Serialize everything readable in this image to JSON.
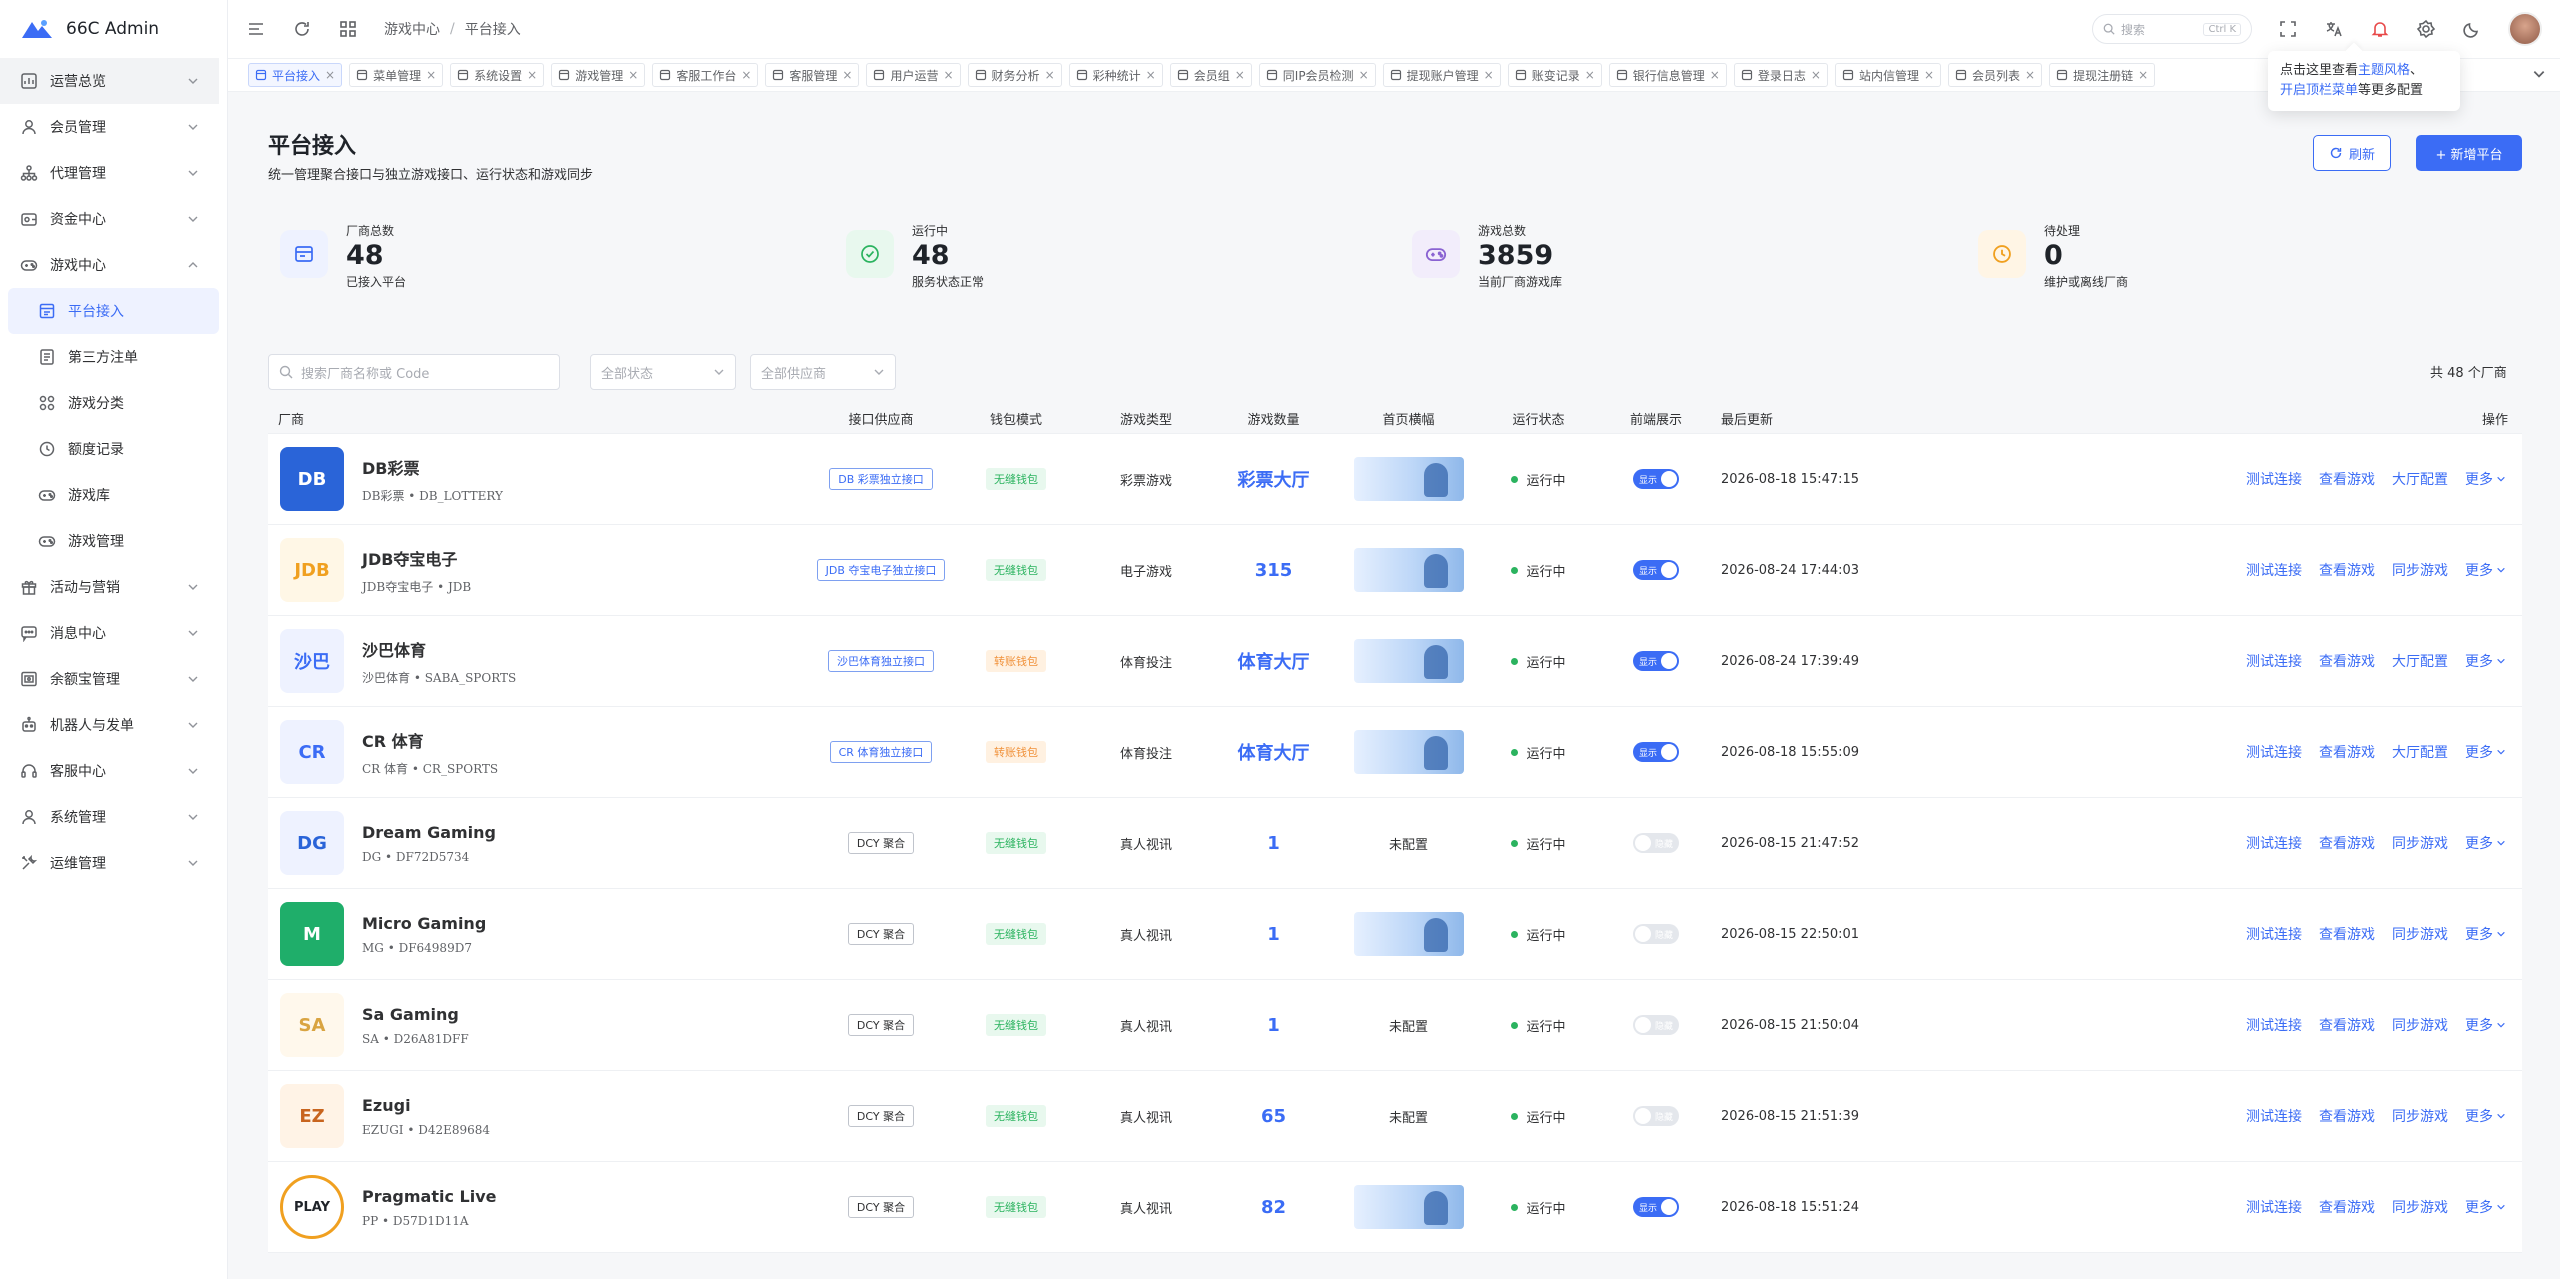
{
  "app": {
    "title": "66C Admin"
  },
  "sidebar": {
    "items": [
      {
        "label": "运营总览",
        "icon": "dashboard-icon",
        "open_bg": true
      },
      {
        "label": "会员管理",
        "icon": "user-icon"
      },
      {
        "label": "代理管理",
        "icon": "agent-tree-icon"
      },
      {
        "label": "资金中心",
        "icon": "wallet-icon"
      },
      {
        "label": "游戏中心",
        "icon": "gamepad-icon",
        "expanded": true
      }
    ],
    "game_sub": [
      {
        "label": "平台接入",
        "icon": "platform-icon",
        "active": true
      },
      {
        "label": "第三方注单",
        "icon": "document-icon"
      },
      {
        "label": "游戏分类",
        "icon": "grid-icon"
      },
      {
        "label": "额度记录",
        "icon": "clock-icon"
      },
      {
        "label": "游戏库",
        "icon": "gamepad-icon"
      },
      {
        "label": "游戏管理",
        "icon": "gamepad-icon"
      }
    ],
    "items_after": [
      {
        "label": "活动与营销",
        "icon": "gift-icon"
      },
      {
        "label": "消息中心",
        "icon": "message-icon"
      },
      {
        "label": "余额宝管理",
        "icon": "safe-icon"
      },
      {
        "label": "机器人与发单",
        "icon": "robot-icon"
      },
      {
        "label": "客服中心",
        "icon": "headset-icon"
      },
      {
        "label": "系统管理",
        "icon": "user-icon"
      },
      {
        "label": "运维管理",
        "icon": "tools-icon"
      }
    ]
  },
  "header": {
    "breadcrumb": [
      "游戏中心",
      "平台接入"
    ],
    "search_placeholder": "搜索",
    "search_kbd": "Ctrl K"
  },
  "tabs": [
    {
      "label": "平台接入",
      "active": true
    },
    {
      "label": "菜单管理"
    },
    {
      "label": "系统设置"
    },
    {
      "label": "游戏管理"
    },
    {
      "label": "客服工作台"
    },
    {
      "label": "客服管理"
    },
    {
      "label": "用户运营"
    },
    {
      "label": "财务分析"
    },
    {
      "label": "彩种统计"
    },
    {
      "label": "会员组"
    },
    {
      "label": "同IP会员检测"
    },
    {
      "label": "提现账户管理"
    },
    {
      "label": "账变记录"
    },
    {
      "label": "银行信息管理"
    },
    {
      "label": "登录日志"
    },
    {
      "label": "站内信管理"
    },
    {
      "label": "会员列表"
    },
    {
      "label": "提现注册链"
    }
  ],
  "tooltip": {
    "pre": "点击这里查看",
    "link1": "主题风格",
    "mid": "、",
    "link2": "开启顶栏菜单",
    "post": "等更多配置"
  },
  "page": {
    "title": "平台接入",
    "desc": "统一管理聚合接口与独立游戏接口、运行状态和游戏同步",
    "refresh": "刷新",
    "add": "+ 新增平台"
  },
  "stats": [
    {
      "label": "厂商总数",
      "value": "48",
      "sub": "已接入平台",
      "color": "#3b6cf5",
      "bg": "#eef2ff",
      "icon": "card-icon"
    },
    {
      "label": "运行中",
      "value": "48",
      "sub": "服务状态正常",
      "color": "#2bb35f",
      "bg": "#e8f8ee",
      "icon": "check-circle-icon"
    },
    {
      "label": "游戏总数",
      "value": "3859",
      "sub": "当前厂商游戏库",
      "color": "#8a63d2",
      "bg": "#f2edfb",
      "icon": "gamepad-icon"
    },
    {
      "label": "待处理",
      "value": "0",
      "sub": "维护或离线厂商",
      "color": "#f0a020",
      "bg": "#fff5e5",
      "icon": "clock-icon"
    }
  ],
  "filters": {
    "search_placeholder": "搜索厂商名称或 Code",
    "status": "全部状态",
    "supplier": "全部供应商",
    "total": "共 48 个厂商"
  },
  "table": {
    "headers": {
      "name": "厂商",
      "api": "接口供应商",
      "wallet": "钱包模式",
      "type": "游戏类型",
      "count": "游戏数量",
      "banner": "首页横幅",
      "status": "运行状态",
      "front": "前端展示",
      "updated": "最后更新",
      "ops": "操作"
    },
    "rows": [
      {
        "name": "DB彩票",
        "code": "DB彩票 • DB_LOTTERY",
        "logo": "DB",
        "logo_bg": "#2a64d8",
        "logo_fg": "#fff",
        "api": "DB 彩票独立接口",
        "api_gray": false,
        "wallet": "无缝钱包",
        "wallet_kind": "g",
        "type": "彩票游戏",
        "count": "彩票大厅",
        "banner": true,
        "status": "运行中",
        "front": "显示",
        "front_on": true,
        "updated": "2026-08-18 15:47:15",
        "ops": [
          "测试连接",
          "查看游戏",
          "大厅配置"
        ],
        "more": "更多"
      },
      {
        "name": "JDB夺宝电子",
        "code": "JDB夺宝电子 • JDB",
        "logo": "JDB",
        "logo_bg": "#fff7e6",
        "logo_fg": "#f0a020",
        "api": "JDB 夺宝电子独立接口",
        "api_gray": false,
        "wallet": "无缝钱包",
        "wallet_kind": "g",
        "type": "电子游戏",
        "count": "315",
        "banner": true,
        "status": "运行中",
        "front": "显示",
        "front_on": true,
        "updated": "2026-08-24 17:44:03",
        "ops": [
          "测试连接",
          "查看游戏",
          "同步游戏"
        ],
        "more": "更多"
      },
      {
        "name": "沙巴体育",
        "code": "沙巴体育 • SABA_SPORTS",
        "logo": "沙巴",
        "logo_bg": "#eef2ff",
        "logo_fg": "#3b6cf5",
        "api": "沙巴体育独立接口",
        "api_gray": false,
        "wallet": "转账钱包",
        "wallet_kind": "o",
        "type": "体育投注",
        "count": "体育大厅",
        "banner": true,
        "status": "运行中",
        "front": "显示",
        "front_on": true,
        "updated": "2026-08-24 17:39:49",
        "ops": [
          "测试连接",
          "查看游戏",
          "大厅配置"
        ],
        "more": "更多"
      },
      {
        "name": "CR 体育",
        "code": "CR 体育 • CR_SPORTS",
        "logo": "CR",
        "logo_bg": "#eef2ff",
        "logo_fg": "#3b6cf5",
        "api": "CR 体育独立接口",
        "api_gray": false,
        "wallet": "转账钱包",
        "wallet_kind": "o",
        "type": "体育投注",
        "count": "体育大厅",
        "banner": true,
        "status": "运行中",
        "front": "显示",
        "front_on": true,
        "updated": "2026-08-18 15:55:09",
        "ops": [
          "测试连接",
          "查看游戏",
          "大厅配置"
        ],
        "more": "更多"
      },
      {
        "name": "Dream Gaming",
        "code": "DG • DF72D5734",
        "logo": "DG",
        "logo_bg": "#eef2ff",
        "logo_fg": "#2a64d8",
        "api": "DCY 聚合",
        "api_gray": true,
        "wallet": "无缝钱包",
        "wallet_kind": "g",
        "type": "真人视讯",
        "count": "1",
        "banner": false,
        "banner_text": "未配置",
        "status": "运行中",
        "front": "隐藏",
        "front_on": false,
        "updated": "2026-08-15 21:47:52",
        "ops": [
          "测试连接",
          "查看游戏",
          "同步游戏"
        ],
        "more": "更多"
      },
      {
        "name": "Micro Gaming",
        "code": "MG • DF64989D7",
        "logo": "M",
        "logo_bg": "#1fae6a",
        "logo_fg": "#fff",
        "api": "DCY 聚合",
        "api_gray": true,
        "wallet": "无缝钱包",
        "wallet_kind": "g",
        "type": "真人视讯",
        "count": "1",
        "banner": true,
        "status": "运行中",
        "front": "隐藏",
        "front_on": false,
        "updated": "2026-08-15 22:50:01",
        "ops": [
          "测试连接",
          "查看游戏",
          "同步游戏"
        ],
        "more": "更多"
      },
      {
        "name": "Sa Gaming",
        "code": "SA • D26A81DFF",
        "logo": "SA",
        "logo_bg": "#fff8ec",
        "logo_fg": "#d9a441",
        "api": "DCY 聚合",
        "api_gray": true,
        "wallet": "无缝钱包",
        "wallet_kind": "g",
        "type": "真人视讯",
        "count": "1",
        "banner": false,
        "banner_text": "未配置",
        "status": "运行中",
        "front": "隐藏",
        "front_on": false,
        "updated": "2026-08-15 21:50:04",
        "ops": [
          "测试连接",
          "查看游戏",
          "同步游戏"
        ],
        "more": "更多"
      },
      {
        "name": "Ezugi",
        "code": "EZUGI • D42E89684",
        "logo": "EZ",
        "logo_bg": "#fff3e6",
        "logo_fg": "#c8641e",
        "api": "DCY 聚合",
        "api_gray": true,
        "wallet": "无缝钱包",
        "wallet_kind": "g",
        "type": "真人视讯",
        "count": "65",
        "banner": false,
        "banner_text": "未配置",
        "status": "运行中",
        "front": "隐藏",
        "front_on": false,
        "updated": "2026-08-15 21:51:39",
        "ops": [
          "测试连接",
          "查看游戏",
          "同步游戏"
        ],
        "more": "更多"
      },
      {
        "name": "Pragmatic Live",
        "code": "PP • D57D1D11A",
        "logo": "PLAY",
        "logo_bg": "#fff",
        "logo_fg": "#1f2329",
        "api": "DCY 聚合",
        "api_gray": true,
        "wallet": "无缝钱包",
        "wallet_kind": "g",
        "type": "真人视讯",
        "count": "82",
        "banner": true,
        "status": "运行中",
        "front": "显示",
        "front_on": true,
        "updated": "2026-08-18 15:51:24",
        "ops": [
          "测试连接",
          "查看游戏",
          "同步游戏"
        ],
        "more": "更多"
      }
    ]
  }
}
